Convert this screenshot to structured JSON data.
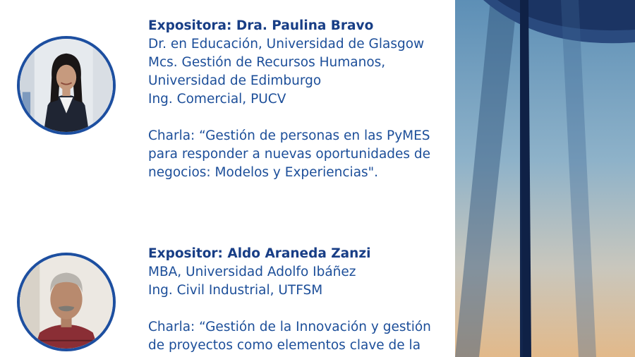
{
  "speakers": [
    {
      "name": "Expositora: Dra. Paulina Bravo",
      "credentials": [
        "Dr. en Educación, Universidad de Glasgow",
        "Mcs. Gestión de Recursos Humanos,",
        "Universidad de Edimburgo",
        "Ing. Comercial, PUCV"
      ],
      "talk": [
        "Charla: “Gestión de personas en las PyMES",
        "para responder a nuevas oportunidades de",
        "negocios: Modelos y Experiencias\"."
      ]
    },
    {
      "name": "Expositor: Aldo Araneda Zanzi",
      "credentials": [
        "MBA, Universidad Adolfo Ibáñez",
        "Ing. Civil Industrial, UTFSM"
      ],
      "talk": [
        "Charla: “Gestión de la Innovación y gestión",
        "de proyectos como elementos clave de la"
      ]
    }
  ],
  "colors": {
    "accent": "#1d4fa0",
    "text": "#1c4e99"
  }
}
